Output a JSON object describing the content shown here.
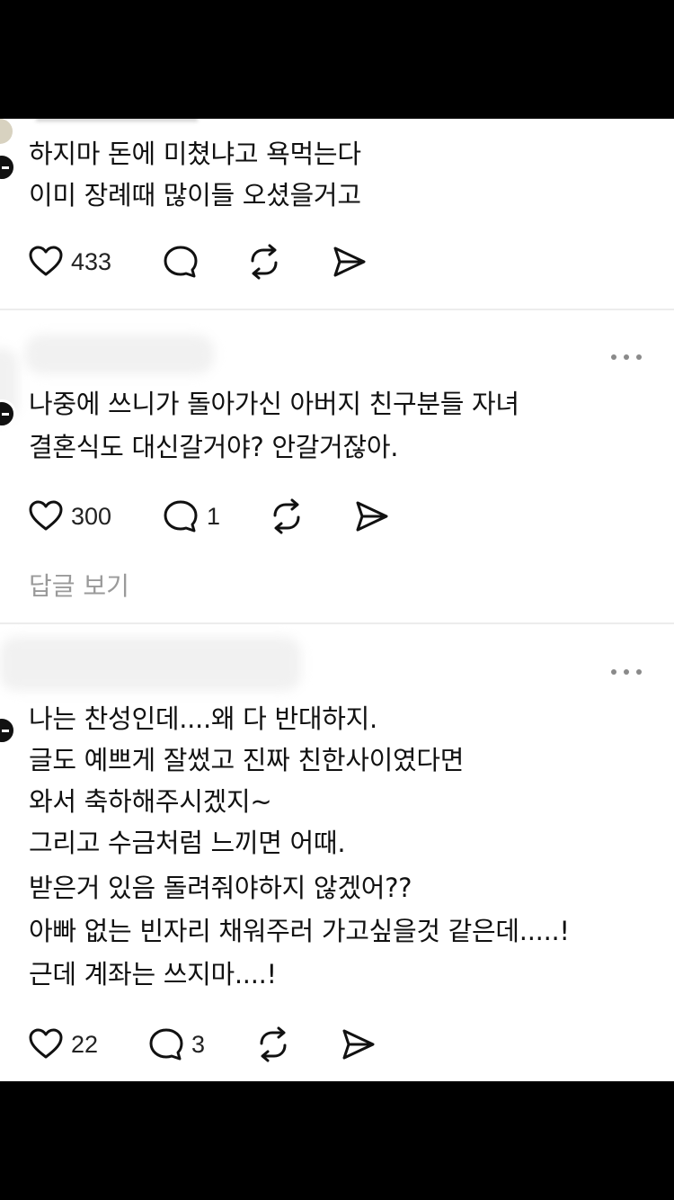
{
  "posts": [
    {
      "lines": [
        "하지마 돈에 미쳤냐고 욕먹는다",
        "이미 장례때 많이들 오셨을거고"
      ],
      "likes": "433",
      "replies": "",
      "reply_link": ""
    },
    {
      "lines": [
        "나중에 쓰니가 돌아가신 아버지 친구분들 자녀",
        "결혼식도 대신갈거야? 안갈거잖아."
      ],
      "likes": "300",
      "replies": "1",
      "reply_link": "답글 보기"
    },
    {
      "lines": [
        "나는 찬성인데....왜 다 반대하지.",
        "글도 예쁘게 잘썼고 진짜 친한사이였다면",
        "와서 축하해주시겠지~",
        "그리고 수금처럼 느끼면 어때.",
        "받은거 있음 돌려줘야하지 않겠어??",
        "아빠 없는 빈자리 채워주러 가고싶을것 같은데.....!",
        "근데 계좌는 쓰지마....!"
      ],
      "likes": "22",
      "replies": "3",
      "reply_link": ""
    }
  ],
  "icons": {
    "like": "heart-icon",
    "reply": "speech-bubble-icon",
    "repost": "repost-icon",
    "share": "send-icon",
    "more": "more-dots-icon"
  }
}
